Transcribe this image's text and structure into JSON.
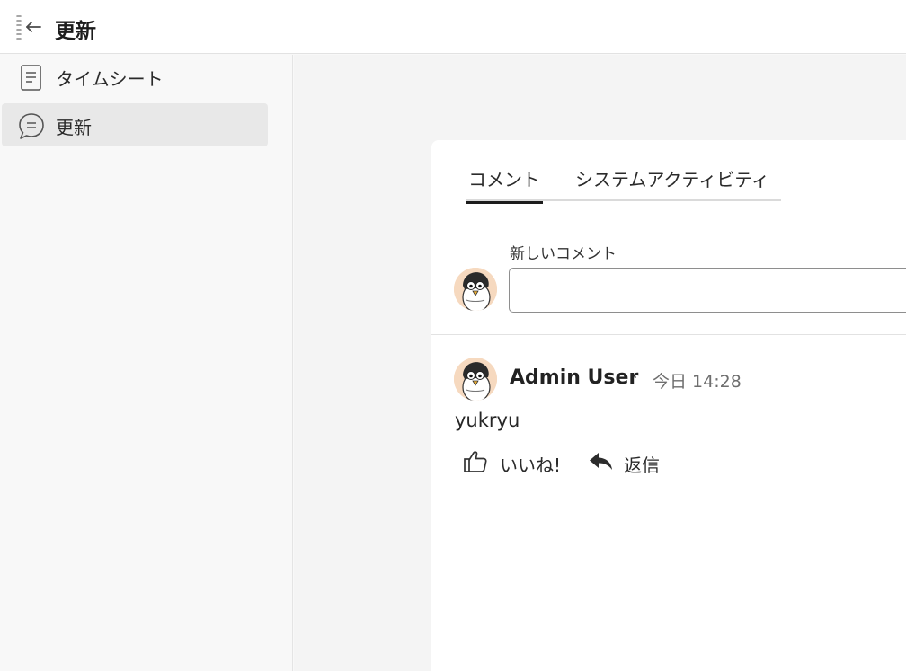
{
  "header": {
    "title": "更新",
    "collapse_icon": "sidebar-collapse-icon"
  },
  "sidebar": {
    "items": [
      {
        "label": "タイムシート",
        "icon": "document-icon",
        "active": false
      },
      {
        "label": "更新",
        "icon": "chat-bubble-icon",
        "active": true
      }
    ]
  },
  "panel": {
    "tabs": [
      {
        "label": "コメント",
        "selected": true
      },
      {
        "label": "システムアクティビティ",
        "selected": false
      }
    ],
    "new_comment": {
      "label": "新しいコメント",
      "value": "",
      "placeholder": ""
    },
    "comments": [
      {
        "author": "Admin User",
        "separator": "·",
        "time": "今日 14:28",
        "body": "yukryu",
        "actions": {
          "like_label": "いいね!",
          "reply_label": "返信"
        }
      }
    ]
  },
  "colors": {
    "accent": "#1c1c1c",
    "active_bg": "#e8e8e8",
    "avatar_bg": "#f6d9bf"
  }
}
